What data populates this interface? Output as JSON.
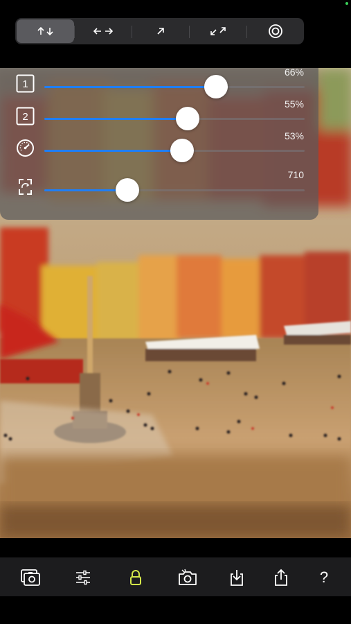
{
  "mode_selector": {
    "options": [
      {
        "name": "vertical-arrows",
        "selected": true
      },
      {
        "name": "horizontal-arrows",
        "selected": false
      },
      {
        "name": "diagonal-arrow",
        "selected": false
      },
      {
        "name": "diagonal-double-arrow",
        "selected": false
      },
      {
        "name": "radial-target",
        "selected": false
      }
    ]
  },
  "sliders": [
    {
      "icon": "number-1-icon",
      "label": "1",
      "value_text": "66%",
      "value": 0.66
    },
    {
      "icon": "number-2-icon",
      "label": "2",
      "value_text": "55%",
      "value": 0.55
    },
    {
      "icon": "speedometer-icon",
      "value_text": "53%",
      "value": 0.53
    },
    {
      "icon": "rotate-frame-icon",
      "value_text": "710",
      "value": 0.32
    }
  ],
  "toolbar": {
    "items": [
      "photos-icon",
      "adjustments-icon",
      "lock-icon",
      "camera-icon",
      "save-icon",
      "share-icon",
      "help-icon"
    ],
    "help_label": "?"
  },
  "colors": {
    "accent": "#1f7ef5",
    "lock_active": "#d4e84a",
    "panel": "#5a5a5c"
  }
}
